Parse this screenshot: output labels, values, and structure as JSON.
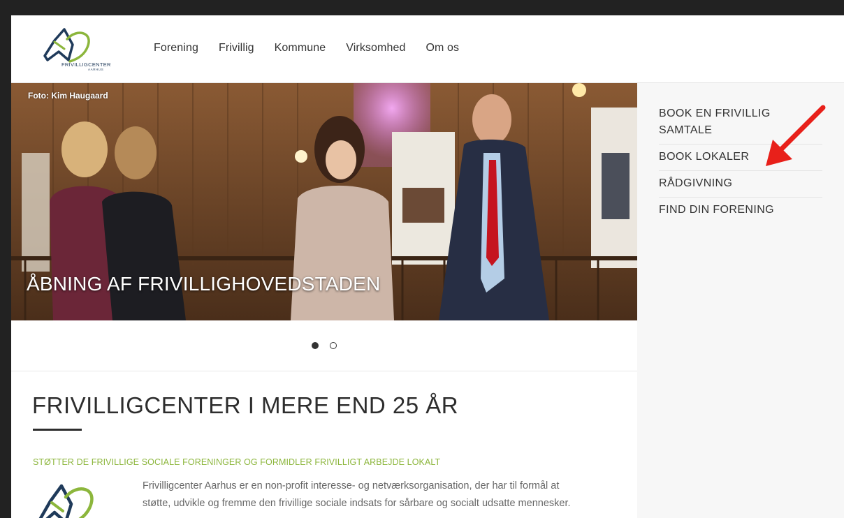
{
  "brand": {
    "logo_text": "FRIVILLIGCENTER",
    "logo_subtext": "AARHUS",
    "color_green": "#8cb63c",
    "color_navy": "#1f3a5a"
  },
  "nav": {
    "items": [
      {
        "label": "Forening"
      },
      {
        "label": "Frivillig"
      },
      {
        "label": "Kommune"
      },
      {
        "label": "Virksomhed"
      },
      {
        "label": "Om os"
      }
    ]
  },
  "hero": {
    "photo_credit": "Foto: Kim Haugaard",
    "caption": "ÅBNING AF FRIVILLIGHOVEDSTADEN",
    "slides": 2,
    "active_slide": 1
  },
  "content": {
    "title": "FRIVILLIGCENTER I MERE END 25 ÅR",
    "subheading": "STØTTER DE FRIVILLIGE SOCIALE FORENINGER OG FORMIDLER FRIVILLIGT ARBEJDE LOKALT",
    "intro_line1": "Frivilligcenter Aarhus er en non-profit interesse- og netværksorganisation, der har til formål at",
    "intro_line2": "støtte, udvikle og fremme den frivillige sociale indsats for sårbare og socialt udsatte mennesker."
  },
  "sidebar": {
    "items": [
      {
        "label": "BOOK EN FRIVILLIG SAMTALE"
      },
      {
        "label": "BOOK LOKALER"
      },
      {
        "label": "RÅDGIVNING"
      },
      {
        "label": "FIND DIN FORENING"
      }
    ]
  },
  "annotation": {
    "arrow_color": "#e8201a"
  }
}
